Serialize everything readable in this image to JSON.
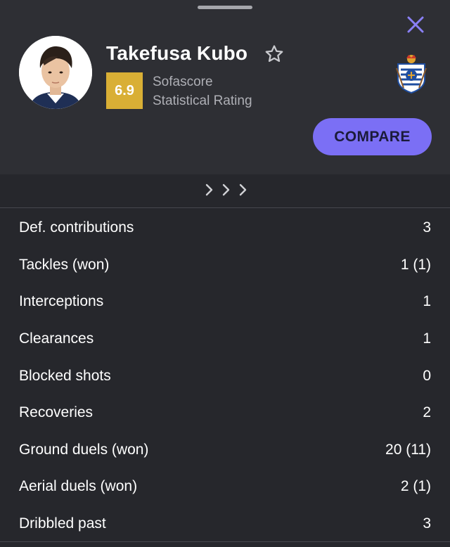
{
  "player": {
    "name": "Takefusa Kubo",
    "rating": "6.9",
    "rating_label_1": "Sofascore",
    "rating_label_2": "Statistical Rating"
  },
  "actions": {
    "compare": "COMPARE"
  },
  "icons": {
    "close": "close-icon",
    "favorite": "star-outline-icon",
    "expand": "chevron-right-icon",
    "team": "team-crest-icon"
  },
  "colors": {
    "accent": "#7b6ff5",
    "rating": "#d9af35",
    "background": "#26272c",
    "header": "#2e2f34"
  },
  "stats": [
    {
      "label": "Def. contributions",
      "value": "3"
    },
    {
      "label": "Tackles (won)",
      "value": "1 (1)"
    },
    {
      "label": "Interceptions",
      "value": "1"
    },
    {
      "label": "Clearances",
      "value": "1"
    },
    {
      "label": "Blocked shots",
      "value": "0"
    },
    {
      "label": "Recoveries",
      "value": "2"
    },
    {
      "label": "Ground duels (won)",
      "value": "20 (11)"
    },
    {
      "label": "Aerial duels (won)",
      "value": "2 (1)"
    },
    {
      "label": "Dribbled past",
      "value": "3"
    }
  ]
}
